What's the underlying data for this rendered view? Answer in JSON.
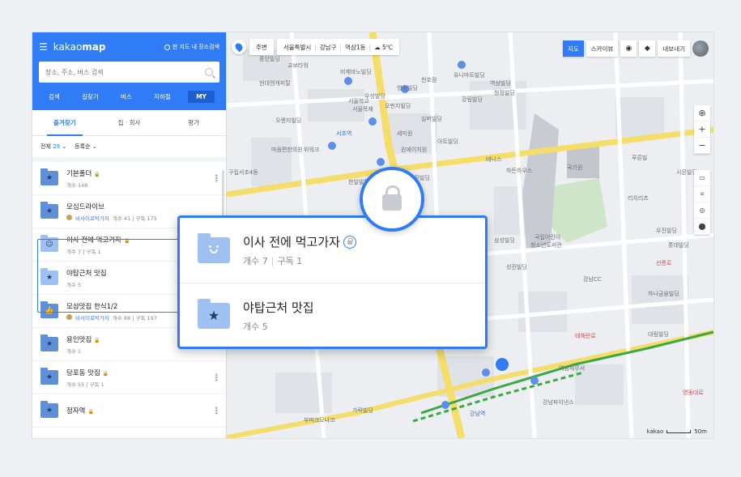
{
  "app": {
    "logo_a": "kakao",
    "logo_b": "map",
    "scope_label": "현 지도 내 장소검색"
  },
  "search": {
    "placeholder": "장소, 주소, 버스 검색"
  },
  "nav_tabs": [
    "검색",
    "길찾기",
    "버스",
    "지하철",
    "MY"
  ],
  "sub_tabs": [
    "즐겨찾기",
    "집 · 회사",
    "평가"
  ],
  "filter": {
    "all": "전체",
    "count": "29",
    "sort": "등록순"
  },
  "favorites": [
    {
      "title": "기본폴더",
      "meta": "개수 148",
      "icon": "star-icon"
    },
    {
      "title": "모심드라이브",
      "owner": "비사이로막가자",
      "meta": "개수 41 | 구독 175",
      "icon": "star-icon"
    },
    {
      "title": "이사 전에 먹고가자",
      "meta": "개수 7 | 구독 1",
      "icon": "smile-icon"
    },
    {
      "title": "야탑근처 맛집",
      "meta": "개수 5",
      "icon": "star-icon"
    },
    {
      "title": "모삼맛집 한식1/2",
      "owner": "비사이로막가자",
      "meta": "개수 88 | 구독 197",
      "icon": "thumb-icon"
    },
    {
      "title": "용인맛집",
      "meta": "개수 1",
      "icon": "star-icon"
    },
    {
      "title": "당포동 맛집",
      "meta": "개수 55 | 구독 1",
      "icon": "star-icon"
    },
    {
      "title": "정자역",
      "meta": "",
      "icon": "star-icon"
    }
  ],
  "popup": {
    "item1": {
      "title": "이사 전에 먹고가자",
      "count": "개수 7",
      "subs": "구독 1"
    },
    "item2": {
      "title": "야탑근처 맛집",
      "count": "개수 5"
    }
  },
  "map_toolbar": {
    "mode": "주변",
    "region1": "서울특별시",
    "region2": "강남구",
    "region3": "역삼1동",
    "weather": "5℃"
  },
  "map_right": {
    "map": "지도",
    "sky": "스카이뷰",
    "share": "내보내기"
  },
  "scale": {
    "brand": "kakao",
    "dist": "50m"
  },
  "map_labels": [
    "중앙빌딩",
    "교보타워",
    "비제바노빌딩",
    "현대엔캐피탈",
    "우성빌딩",
    "영동빌딩",
    "유니마트빌딩",
    "천호점",
    "서울학교",
    "서울목재",
    "역삼빌딩",
    "청정빌딩",
    "오펀지빌딩",
    "오랜지빌딩",
    "강림빌딩",
    "실버빌딩",
    "세미원",
    "위워크",
    "마음편한의원",
    "구립서초4동",
    "아트빌딩",
    "서초역",
    "한일빌딩",
    "원에이치원",
    "유진빌딩",
    "테니스",
    "하든하우스",
    "국기원",
    "리치리츠",
    "푸른빌",
    "청소년도서관",
    "국립어린이",
    "삼성빌딩",
    "성진빌딩",
    "강남역",
    "역삼세무서",
    "선릉로",
    "하나금융빌딩",
    "테헤란로",
    "영동대로",
    "시몬빌딩",
    "롯데빌딩",
    "우진빌딩",
    "대림빌딩",
    "강남파이낸스",
    "강남CC",
    "부띠크모나코",
    "가락빌딩"
  ]
}
